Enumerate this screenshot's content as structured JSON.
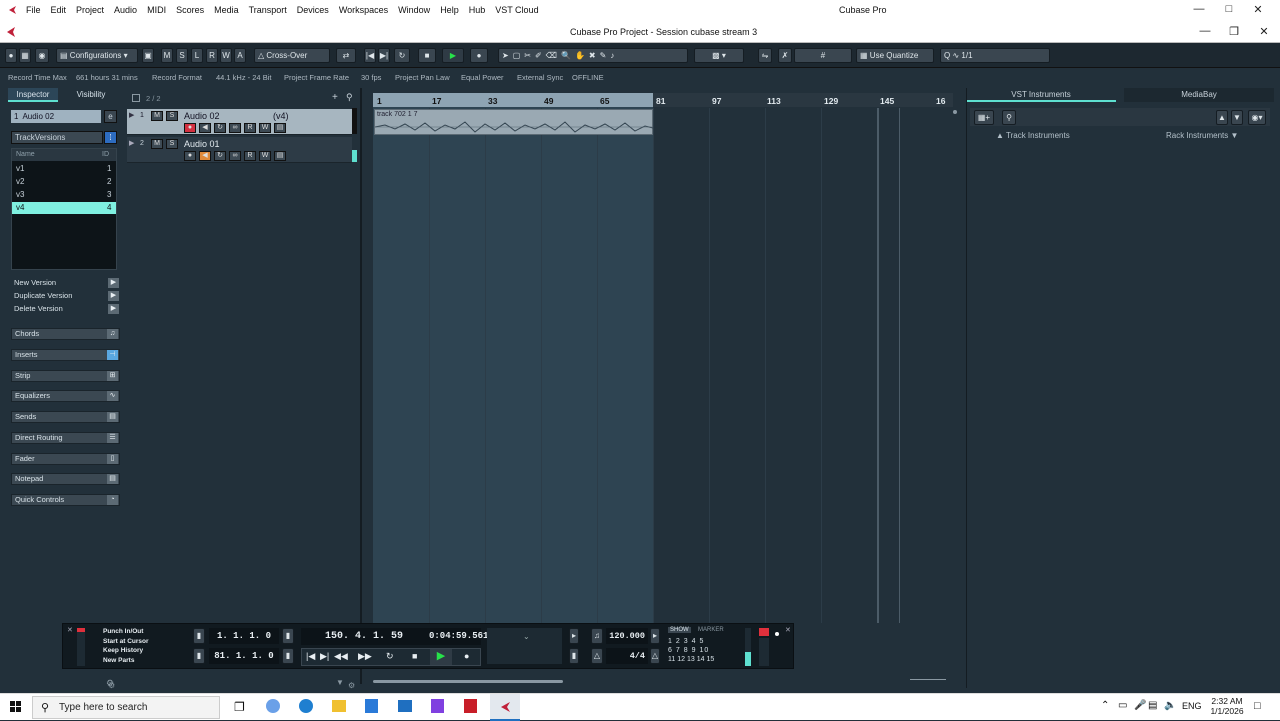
{
  "os_titlebar": {
    "menus": [
      "File",
      "Edit",
      "Project",
      "Audio",
      "MIDI",
      "Scores",
      "Media",
      "Transport",
      "Devices",
      "Workspaces",
      "Window",
      "Help",
      "Hub",
      "VST Cloud"
    ],
    "app_title": "Cubase Pro"
  },
  "project_window": {
    "title": "Cubase Pro Project - Session cubase stream 3"
  },
  "toolbar": {
    "configurations": "Configurations",
    "m": "M",
    "s": "S",
    "l": "L",
    "r": "R",
    "w": "W",
    "a": "A",
    "crossover": "Cross-Over",
    "quantize_mode": "Use Quantize",
    "grid_value": "1/1"
  },
  "status_line": {
    "record_time_max_label": "Record Time Max",
    "record_time_max_value": "661 hours 31 mins",
    "record_format_label": "Record Format",
    "record_format_value": "44.1 kHz - 24 Bit",
    "frame_rate_label": "Project Frame Rate",
    "frame_rate_value": "30 fps",
    "pan_law_label": "Project Pan Law",
    "pan_law_value": "Equal Power",
    "external_sync_label": "External Sync",
    "external_sync_value": "OFFLINE"
  },
  "inspector": {
    "tabs": [
      "Inspector",
      "Visibility"
    ],
    "track_number": "1",
    "track_name": "Audio 02",
    "track_versions_label": "TrackVersions",
    "versions_header": {
      "name": "Name",
      "id": "ID"
    },
    "versions": [
      {
        "name": "v1",
        "id": "1"
      },
      {
        "name": "v2",
        "id": "2"
      },
      {
        "name": "v3",
        "id": "3"
      },
      {
        "name": "v4",
        "id": "4"
      }
    ],
    "version_actions": [
      "New Version",
      "Duplicate Version",
      "Delete Version"
    ],
    "sections": [
      "Chords",
      "Inserts",
      "Strip",
      "Equalizers",
      "Sends",
      "Direct Routing",
      "Fader",
      "Notepad",
      "Quick Controls"
    ]
  },
  "track_list": {
    "count": "2 / 2",
    "tracks": [
      {
        "number": "1",
        "name": "Audio 02",
        "version": "(v4)",
        "m": "M",
        "s": "S",
        "r": "R",
        "w": "W"
      },
      {
        "number": "2",
        "name": "Audio 01",
        "version": "",
        "m": "M",
        "s": "S",
        "r": "R",
        "w": "W"
      }
    ]
  },
  "arrange": {
    "ruler_marks": [
      "1",
      "17",
      "33",
      "49",
      "65",
      "81",
      "97",
      "113",
      "129",
      "145",
      "16"
    ],
    "event_label": "track 702 1 7"
  },
  "right_zone": {
    "tabs": [
      "VST Instruments",
      "MediaBay"
    ],
    "track_instruments": "Track Instruments",
    "rack_instruments": "Rack Instruments"
  },
  "transport": {
    "punch": "Punch In/Out",
    "start_at_cursor": "Start at Cursor",
    "keep_history": "Keep History",
    "new_parts": "New Parts",
    "left_locator": "1. 1. 1.   0",
    "right_locator": "81. 1. 1.   0",
    "position_bars": "150. 4. 1. 59",
    "position_time": "0:04:59.561",
    "tempo": "120.000",
    "signature": "4/4",
    "show_label": "SHOW",
    "marker_label": "MARKER",
    "marker_rows": [
      [
        "1",
        "2",
        "3",
        "4",
        "5"
      ],
      [
        "6",
        "7",
        "8",
        "9",
        "10"
      ],
      [
        "11",
        "12",
        "13",
        "14",
        "15"
      ]
    ]
  },
  "taskbar": {
    "search_placeholder": "Type here to search",
    "language": "ENG",
    "time": "2:32 AM",
    "date": "1/1/2026"
  },
  "colors": {
    "accent": "#5ee0d0",
    "play_green": "#27e24a",
    "record_red": "#e0303c",
    "background": "#22303a"
  }
}
